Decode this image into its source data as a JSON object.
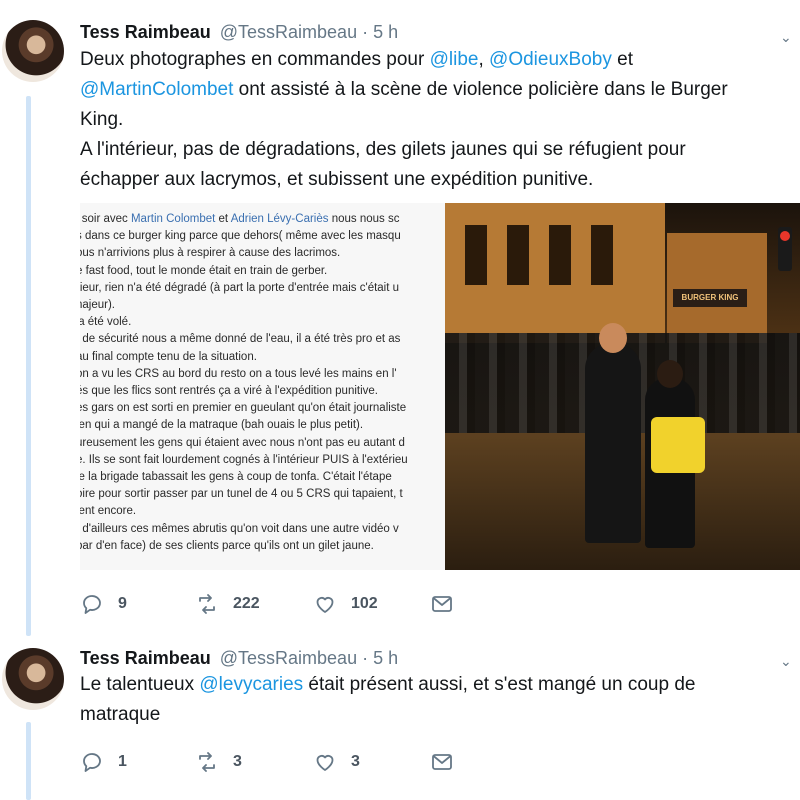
{
  "tweets": [
    {
      "author_name": "Tess Raimbeau",
      "author_handle": "@TessRaimbeau",
      "separator": "·",
      "time": "5 h",
      "text_lines": [
        [
          {
            "t": "Deux photographes en commandes pour "
          },
          {
            "t": "@libe",
            "m": true
          },
          {
            "t": ", "
          },
          {
            "t": "@OdieuxBoby",
            "m": true
          },
          {
            "t": " et"
          }
        ],
        [
          {
            "t": "@MartinColombet",
            "m": true
          },
          {
            "t": " ont assisté à la scène de violence policière dans le Burger"
          }
        ],
        [
          {
            "t": "King."
          }
        ],
        [
          {
            "t": "A l'intérieur, pas de dégradations, des gilets jaunes qui se réfugient pour"
          }
        ],
        [
          {
            "t": "échapper aux lacrymos, et subissent une expédition punitive."
          }
        ]
      ],
      "media": {
        "note_lines": [
          [
            {
              "t": "i soir avec "
            },
            {
              "t": "Martin Colombet",
              "b": true
            },
            {
              "t": " et "
            },
            {
              "t": "Adrien Lévy-Cariès",
              "b": true
            },
            {
              "t": " nous nous sc"
            }
          ],
          [
            {
              "t": "s dans ce burger king parce que dehors( même avec les masqu"
            }
          ],
          [
            {
              "t": "ous n'arrivions plus à respirer à cause des lacrimos."
            }
          ],
          [
            {
              "t": "e fast food, tout le monde était en train de gerber."
            }
          ],
          [
            {
              "t": "rieur, rien n'a été dégradé (à part la porte d'entrée mais c'était u"
            }
          ],
          [
            {
              "t": "najeur)."
            }
          ],
          [
            {
              "t": "'a été volé."
            }
          ],
          [
            {
              "t": "t de sécurité nous a même donné de l'eau, il a été très pro et as"
            }
          ],
          [
            {
              "t": "au final compte tenu de la situation."
            }
          ],
          [
            {
              "t": " on a vu les CRS au bord du resto on a tous levé les mains en l'"
            }
          ],
          [
            {
              "t": "és que les flics sont rentrés ça a viré à l'expédition punitive."
            }
          ],
          [
            {
              "t": "es gars on est sorti en premier en gueulant qu'on était journaliste"
            }
          ],
          [
            {
              "t": "ien qui a mangé de la matraque (bah ouais le plus petit)."
            }
          ],
          [
            {
              "t": "ureusement les gens qui étaient avec nous n'ont pas eu autant d"
            }
          ],
          [
            {
              "t": "e. Ils se sont fait lourdement cognés à l'intérieur PUIS à l'extérieu"
            }
          ],
          [
            {
              "t": "le la brigade tabassait les gens à coup de tonfa. C'était l'étape"
            }
          ],
          [
            {
              "t": "oire pour sortir passer par un tunel de 4 ou 5 CRS qui tapaient, t"
            }
          ],
          [
            {
              "t": "ient encore."
            }
          ],
          [
            {
              "t": "t d'ailleurs ces mêmes abrutis qu'on voit dans une autre vidéo v"
            }
          ],
          [
            {
              "t": " bar d'en face) de ses clients parce qu'ils ont un gilet jaune."
            }
          ]
        ],
        "photo_sign": "BURGER KING"
      },
      "actions": {
        "replies": "9",
        "retweets": "222",
        "likes": "102"
      }
    },
    {
      "author_name": "Tess Raimbeau",
      "author_handle": "@TessRaimbeau",
      "separator": "·",
      "time": "5 h",
      "text_lines": [
        [
          {
            "t": "Le talentueux "
          },
          {
            "t": "@levycaries",
            "m": true
          },
          {
            "t": " était présent aussi, et s'est mangé un coup de"
          }
        ],
        [
          {
            "t": "matraque"
          }
        ]
      ],
      "actions": {
        "replies": "1",
        "retweets": "3",
        "likes": "3"
      }
    }
  ],
  "icons": {
    "reply": "reply-icon",
    "retweet": "retweet-icon",
    "like": "heart-icon",
    "dm": "envelope-icon",
    "caret": "chevron-down-icon"
  },
  "colors": {
    "mention": "#1b95e0",
    "thread_line": "#cfe3f7",
    "muted": "#657786"
  }
}
